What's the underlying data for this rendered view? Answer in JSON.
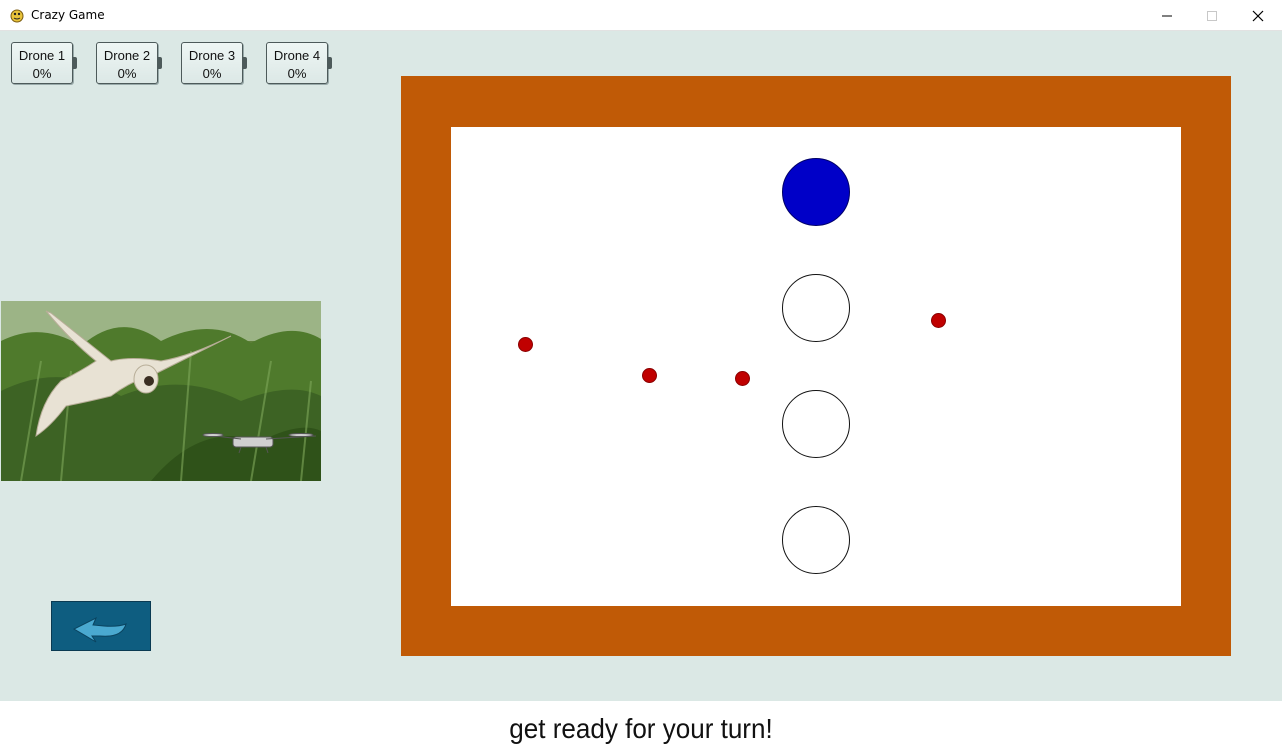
{
  "window": {
    "title": "Crazy Game"
  },
  "drones": [
    {
      "name": "Drone 1",
      "value": "0%"
    },
    {
      "name": "Drone 2",
      "value": "0%"
    },
    {
      "name": "Drone 3",
      "value": "0%"
    },
    {
      "name": "Drone 4",
      "value": "0%"
    }
  ],
  "colors": {
    "background": "#dbe8e5",
    "board_frame": "#c05a06",
    "player_disc": "#0000c8",
    "dots": "#c00000",
    "back_button": "#0e5d80"
  },
  "icons": {
    "back_button": "back-arrow-icon",
    "app": "pygame-snake-icon"
  },
  "status": "get ready for your turn!"
}
